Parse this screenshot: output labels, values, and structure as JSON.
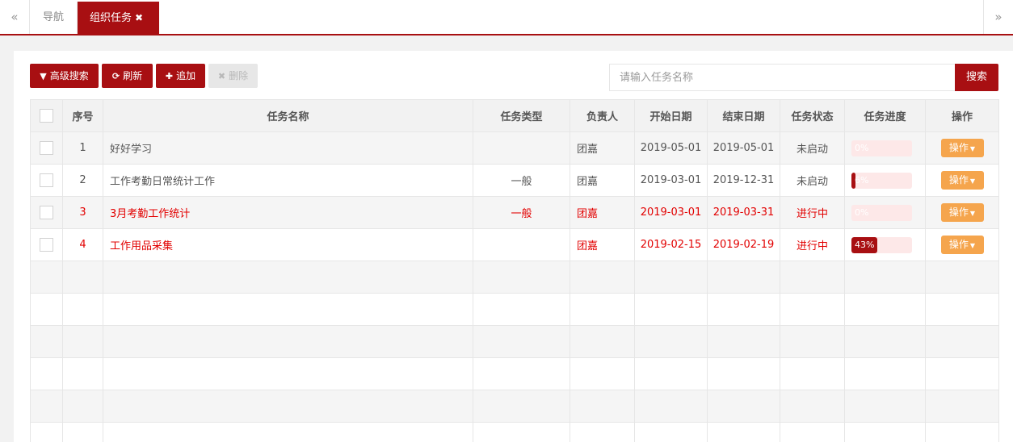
{
  "tabs": {
    "prev_icon": "«",
    "next_icon": "»",
    "home_label": "导航",
    "active_label": "组织任务",
    "close_icon": "✖"
  },
  "toolbar": {
    "advanced_search": {
      "icon": "▼",
      "label": "高级搜索"
    },
    "refresh": {
      "icon": "⟳",
      "label": "刷新"
    },
    "add": {
      "icon": "✚",
      "label": "追加"
    },
    "delete": {
      "icon": "✖",
      "label": "删除"
    }
  },
  "search": {
    "placeholder": "请输入任务名称",
    "button_label": "搜索"
  },
  "colors": {
    "primary": "#a80f12",
    "warning": "#f5a54d",
    "danger_text": "#e20000"
  },
  "table": {
    "headers": {
      "index": "序号",
      "name": "任务名称",
      "type": "任务类型",
      "owner": "负责人",
      "start": "开始日期",
      "end": "结束日期",
      "status": "任务状态",
      "progress": "任务进度",
      "action": "操作"
    },
    "rows": [
      {
        "index": "1",
        "name": "好好学习",
        "type": "",
        "owner": "团嘉",
        "start": "2019-05-01",
        "end": "2019-05-01",
        "status": "未启动",
        "progress": 0,
        "progress_text": "0%",
        "action": "操作"
      },
      {
        "index": "2",
        "name": "工作考勤日常统计工作",
        "type": "一般",
        "owner": "团嘉",
        "start": "2019-03-01",
        "end": "2019-12-31",
        "status": "未启动",
        "progress": 6,
        "progress_text": "6%",
        "action": "操作"
      },
      {
        "index": "3",
        "name": "3月考勤工作统计",
        "type": "一般",
        "owner": "团嘉",
        "start": "2019-03-01",
        "end": "2019-03-31",
        "status": "进行中",
        "progress": 0,
        "progress_text": "0%",
        "action": "操作"
      },
      {
        "index": "4",
        "name": "工作用品采集",
        "type": "",
        "owner": "团嘉",
        "start": "2019-02-15",
        "end": "2019-02-19",
        "status": "进行中",
        "progress": 43,
        "progress_text": "43%",
        "action": "操作"
      }
    ]
  }
}
